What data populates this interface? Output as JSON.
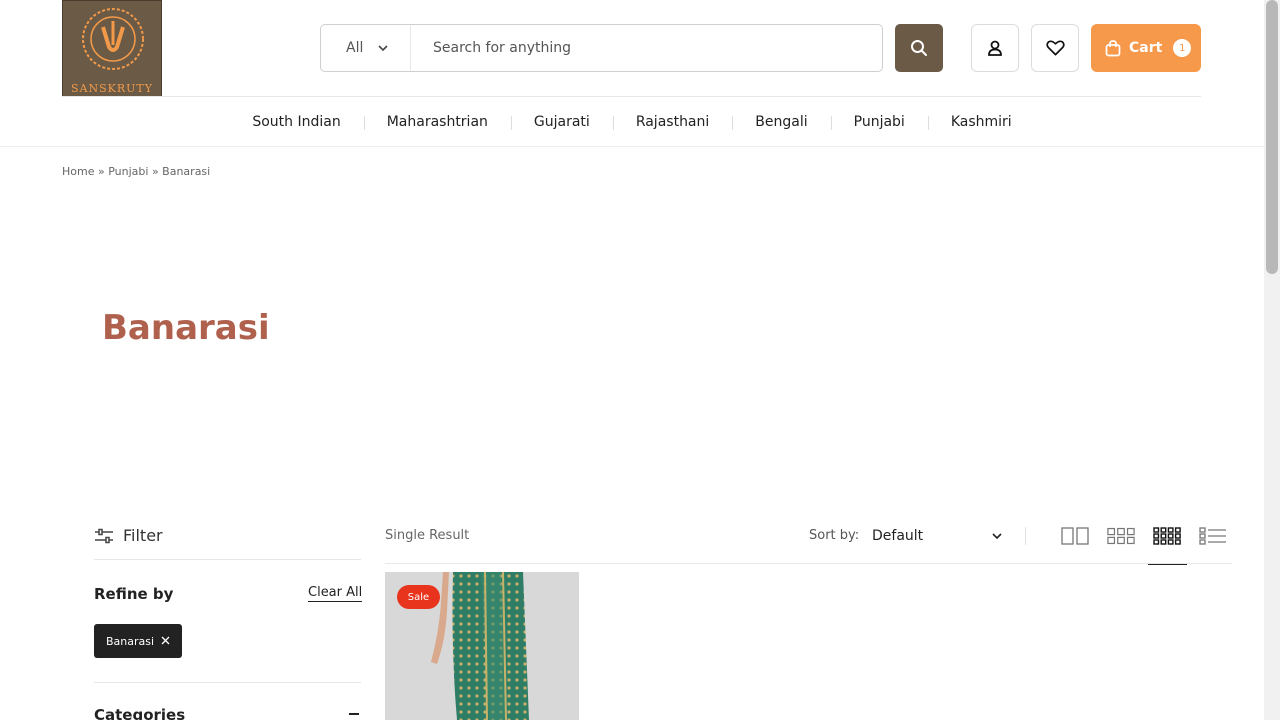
{
  "brand": {
    "name": "SANSKRUTY"
  },
  "search": {
    "category": "All",
    "placeholder": "Search for anything"
  },
  "cart": {
    "label": "Cart",
    "count": "1"
  },
  "nav": [
    "South Indian",
    "Maharashtrian",
    "Gujarati",
    "Rajasthani",
    "Bengali",
    "Punjabi",
    "Kashmiri"
  ],
  "breadcrumb": {
    "home": "Home",
    "sep": "»",
    "parent": "Punjabi",
    "current": "Banarasi"
  },
  "page": {
    "title": "Banarasi"
  },
  "sidebar": {
    "filter_label": "Filter",
    "refine_label": "Refine by",
    "clear_label": "Clear All",
    "active_filter": "Banarasi",
    "categories_label": "Categories"
  },
  "toolbar": {
    "result_text": "Single Result",
    "sort_label": "Sort by:",
    "sort_value": "Default"
  },
  "product": {
    "badge": "Sale"
  },
  "colors": {
    "accent": "#f7994a",
    "brand": "#6b5a45",
    "title": "#b0614e",
    "sale": "#e8341c"
  }
}
